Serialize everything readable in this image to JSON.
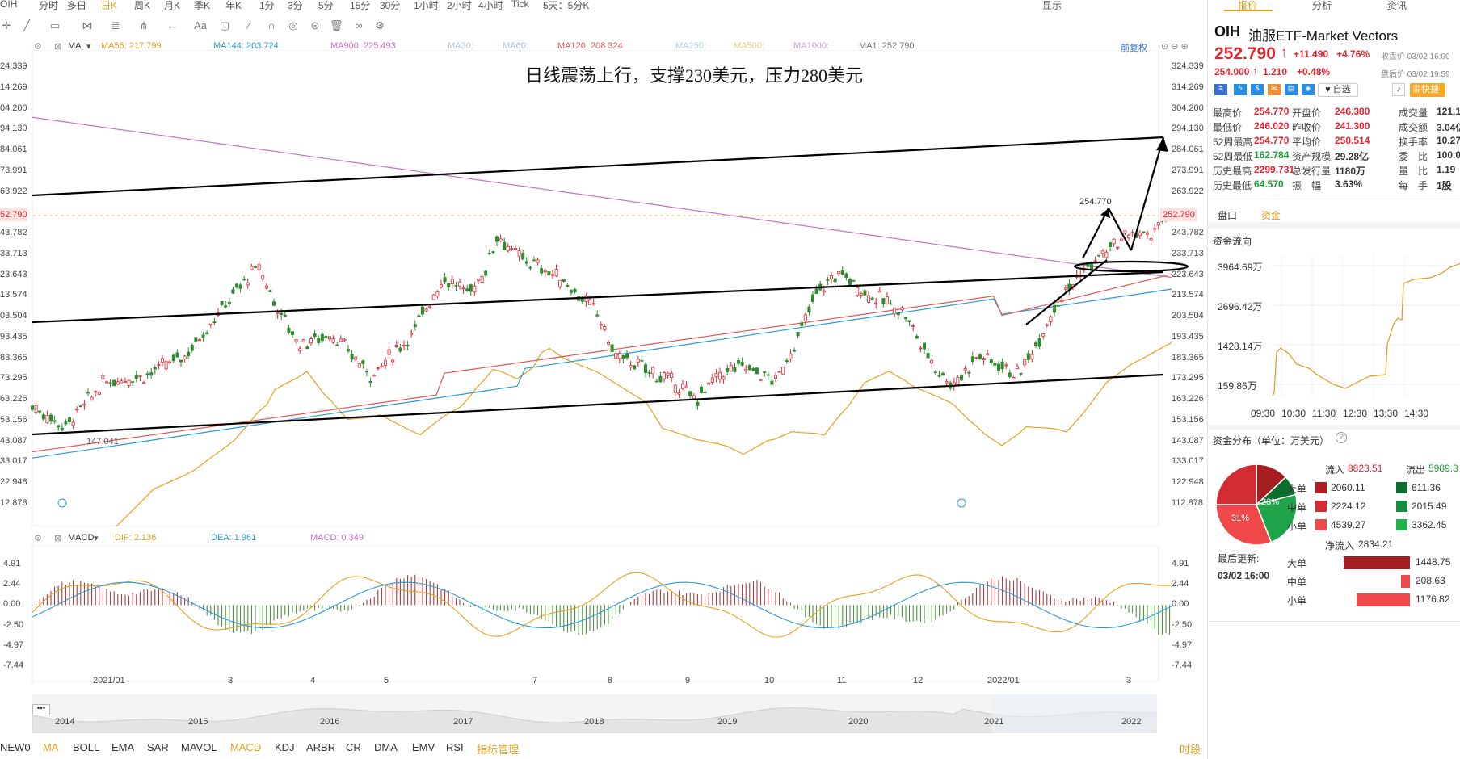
{
  "top_periods": [
    "OIH",
    "分时",
    "多日",
    "日K",
    "周K",
    "月K",
    "季K",
    "年K",
    "1分",
    "3分",
    "5分",
    "15分",
    "30分",
    "1小时",
    "2小时",
    "4小时",
    "Tick",
    "5天：5分K"
  ],
  "top_right": {
    "display": "显示"
  },
  "ma_legend": {
    "ma": "MA",
    "ma55": "MA55: 217.799",
    "ma144": "MA144: 203.724",
    "ma900": "MA900: 225.493",
    "ma30": "MA30:",
    "ma60": "MA60:",
    "ma120": "MA120: 208.324",
    "ma250": "MA250:",
    "ma500": "MA500:",
    "ma1000": "MA1000:",
    "ma1": "MA1: 252.790",
    "fuquan": "前复权"
  },
  "annotation": "日线震荡上行，支撑230美元，压力280美元",
  "price_axis": [
    "324.339",
    "314.269",
    "304.200",
    "294.130",
    "284.061",
    "273.991",
    "263.922",
    "252.790",
    "243.782",
    "233.713",
    "223.643",
    "213.574",
    "203.504",
    "193.435",
    "183.365",
    "173.295",
    "163.226",
    "153.156",
    "143.087",
    "133.017",
    "122.948",
    "112.878"
  ],
  "left_axis": [
    "24.339",
    "14.269",
    "04.200",
    "94.130",
    "84.061",
    "73.991",
    "63.922",
    "52.790",
    "43.782",
    "33.713",
    "23.643",
    "13.574",
    "03.504",
    "93.435",
    "83.365",
    "73.295",
    "63.226",
    "53.156",
    "43.087",
    "33.017",
    "22.948",
    "12.878"
  ],
  "price_marks": {
    "high": "254.770",
    "low": "147.041",
    "current": "252.790"
  },
  "macd_legend": {
    "name": "MACD",
    "dif": "DIF: 2.136",
    "dea": "DEA: 1.961",
    "macd": "MACD: 0.349"
  },
  "macd_axis": [
    "4.91",
    "2.44",
    "0.00",
    "-2.50",
    "-4.97",
    "-7.44"
  ],
  "x_months": [
    "2021/01",
    "3",
    "4",
    "5",
    "7",
    "8",
    "9",
    "10",
    "11",
    "12",
    "2022/01",
    "3"
  ],
  "nav_years": [
    "2014",
    "2015",
    "2016",
    "2017",
    "2018",
    "2019",
    "2020",
    "2021",
    "2022"
  ],
  "bottom_tabs": [
    "NEW0",
    "MA",
    "BOLL",
    "EMA",
    "SAR",
    "MAVOL",
    "MACD",
    "KDJ",
    "ARBR",
    "CR",
    "DMA",
    "EMV",
    "RSI",
    "指标管理"
  ],
  "bottom_right": "时段",
  "panel": {
    "tabs": [
      "报价",
      "分析",
      "资讯"
    ],
    "code": "OIH",
    "name": "油服ETF-Market Vectors",
    "price": "252.790",
    "change": "+11.490",
    "change_pct": "+4.76%",
    "close_label": "收盘价 03/02 16:00",
    "after_price": "254.000",
    "after_change": "1.210",
    "after_pct": "+0.48%",
    "after_label": "盘后价 03/02 19:59",
    "watch": "自选",
    "quick": "快捷",
    "stats": [
      [
        "最高价",
        "254.770",
        "开盘价",
        "246.380",
        "成交量",
        "121.1"
      ],
      [
        "最低价",
        "246.020",
        "昨收价",
        "241.300",
        "成交额",
        "3.04亿"
      ],
      [
        "52周最高",
        "254.770",
        "平均价",
        "250.514",
        "换手率",
        "10.27"
      ],
      [
        "52周最低",
        "162.784",
        "资产规模",
        "29.28亿",
        "委　比",
        "100.0"
      ],
      [
        "历史最高",
        "2299.731",
        "总发行量",
        "1180万",
        "量　比",
        "1.19"
      ],
      [
        "历史最低",
        "64.570",
        "振　幅",
        "3.63%",
        "每　手",
        "1股"
      ]
    ],
    "subtabs": [
      "盘口",
      "资金"
    ],
    "flow_title": "资金流向",
    "flow_axis": [
      "3964.69万",
      "2696.42万",
      "1428.14万",
      "159.86万"
    ],
    "flow_times": [
      "09:30",
      "10:30",
      "11:30",
      "12:30",
      "13:30",
      "14:30"
    ],
    "dist_title": "资金分布（单位：万美元）",
    "inflow_label": "流入",
    "inflow_total": "8823.51",
    "outflow_label": "流出",
    "outflow_total": "5989.3",
    "rows": [
      {
        "label": "大单",
        "in": "2060.11",
        "out": "611.36"
      },
      {
        "label": "中单",
        "in": "2224.12",
        "out": "2015.49"
      },
      {
        "label": "小单",
        "in": "4539.27",
        "out": "3362.45"
      }
    ],
    "pie_labels": {
      "a": "23%",
      "b": "31%"
    },
    "net_label": "净流入",
    "net_total": "2834.21",
    "net_rows": [
      {
        "label": "大单",
        "value": "1448.75",
        "frac": 1.0
      },
      {
        "label": "中单",
        "value": "208.63",
        "frac": 0.14
      },
      {
        "label": "小单",
        "value": "1176.82",
        "frac": 0.81
      }
    ],
    "updated_label": "最后更新:",
    "updated_time": "03/02 16:00"
  }
}
